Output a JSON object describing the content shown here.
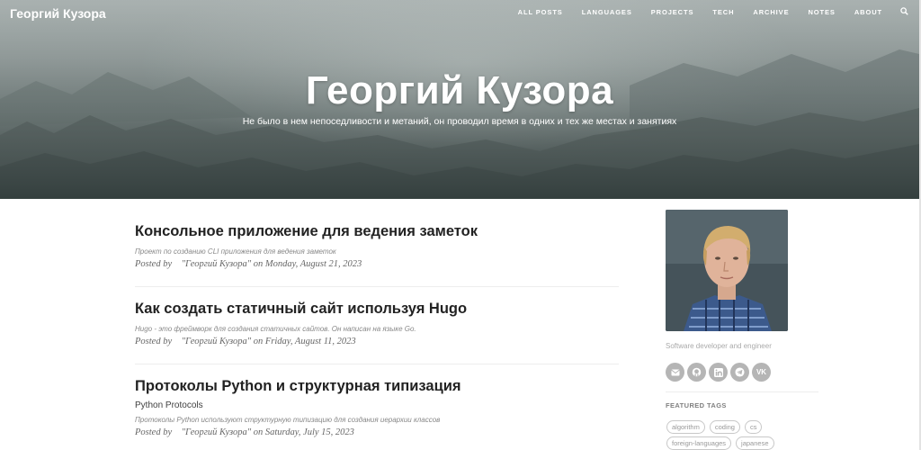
{
  "site": {
    "brand": "Георгий Кузора",
    "title": "Георгий Кузора",
    "subtitle": "Не было в нем непоседливости и метаний, он проводил время в одних и тех же местах и занятиях"
  },
  "nav": {
    "items": [
      {
        "label": "ALL POSTS"
      },
      {
        "label": "LANGUAGES"
      },
      {
        "label": "PROJECTS"
      },
      {
        "label": "TECH"
      },
      {
        "label": "ARCHIVE"
      },
      {
        "label": "NOTES"
      },
      {
        "label": "ABOUT"
      }
    ],
    "search_icon": "search-icon"
  },
  "posts": [
    {
      "title": "Консольное приложение для ведения заметок",
      "subtitle": "",
      "excerpt": "Проект по созданию CLI приложения для ведения заметок",
      "posted_by": "Posted by",
      "author": "\"Георгий Кузора\"",
      "on": "on",
      "date": "Monday, August 21, 2023"
    },
    {
      "title": "Как создать статичный сайт используя Hugo",
      "subtitle": "",
      "excerpt": "Hugo - это фреймворк для создания статичных сайтов. Он написан на языке Go.",
      "posted_by": "Posted by",
      "author": "\"Георгий Кузора\"",
      "on": "on",
      "date": "Friday, August 11, 2023"
    },
    {
      "title": "Протоколы Python и структурная типизация",
      "subtitle": "Python Protocols",
      "excerpt": "Протоколы Python используют структурную типизацию для создания иерархии классов",
      "posted_by": "Posted by",
      "author": "\"Георгий Кузора\"",
      "on": "on",
      "date": "Saturday, July 15, 2023"
    }
  ],
  "sidebar": {
    "description": "Software developer and engineer",
    "social": [
      {
        "icon": "email-icon"
      },
      {
        "icon": "github-icon"
      },
      {
        "icon": "linkedin-icon"
      },
      {
        "icon": "telegram-icon"
      },
      {
        "icon": "vk-icon",
        "label": "VK"
      }
    ],
    "featured_tags_heading": "FEATURED TAGS",
    "tags": [
      "algorithm",
      "coding",
      "cs",
      "foreign-languages",
      "japanese"
    ]
  },
  "colors": {
    "accent": "#222222",
    "social_bg": "#b5b5b5",
    "meta": "#666666"
  }
}
